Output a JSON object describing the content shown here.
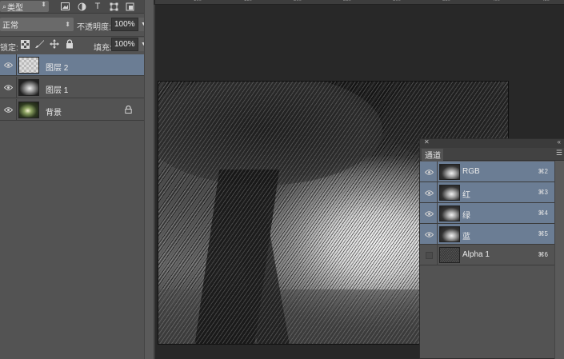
{
  "layers_panel": {
    "filter_label": "类型",
    "filter_icons": [
      "image-filter-icon",
      "adjustment-filter-icon",
      "type-filter-icon",
      "shape-filter-icon",
      "smart-object-filter-icon"
    ],
    "type_icon_glyph": "T",
    "blend_mode": "正常",
    "opacity_label": "不透明度:",
    "opacity_value": "100%",
    "lock_label": "锁定:",
    "fill_label": "填充:",
    "fill_value": "100%",
    "layers": [
      {
        "name": "图层 2",
        "selected": true,
        "thumb": "transparent",
        "locked": false
      },
      {
        "name": "图层 1",
        "selected": false,
        "thumb": "bw",
        "locked": false
      },
      {
        "name": "背景",
        "selected": false,
        "thumb": "color",
        "locked": true
      }
    ]
  },
  "ruler": {
    "numbers": [
      "100",
      "150",
      "200",
      "250",
      "300",
      "350",
      "400",
      "450",
      "500"
    ]
  },
  "channels_panel": {
    "tab_label": "通道",
    "channels": [
      {
        "name": "RGB",
        "shortcut": "⌘2",
        "visible": true,
        "selected": true
      },
      {
        "name": "红",
        "shortcut": "⌘3",
        "visible": true,
        "selected": true
      },
      {
        "name": "绿",
        "shortcut": "⌘4",
        "visible": true,
        "selected": true
      },
      {
        "name": "蓝",
        "shortcut": "⌘5",
        "visible": true,
        "selected": true
      },
      {
        "name": "Alpha 1",
        "shortcut": "⌘6",
        "visible": false,
        "selected": false
      }
    ]
  },
  "colors": {
    "selection": "#6b7d94",
    "panel_bg": "#535353",
    "workspace_bg": "#282828"
  }
}
